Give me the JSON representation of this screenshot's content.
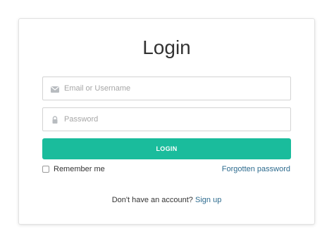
{
  "form": {
    "title": "Login",
    "email": {
      "placeholder": "Email or Username",
      "value": ""
    },
    "password": {
      "placeholder": "Password",
      "value": ""
    },
    "login_button": "LOGIN",
    "remember_me": {
      "label": "Remember me",
      "checked": false
    },
    "forgot_link": "Forgotten password",
    "signup_prompt": "Don't have an account?",
    "signup_link": "Sign up"
  },
  "colors": {
    "accent": "#1abc9c",
    "link": "#2d6b8e",
    "icon": "#b8bcc0"
  },
  "icons": {
    "email": "envelope-icon",
    "password": "lock-icon"
  }
}
